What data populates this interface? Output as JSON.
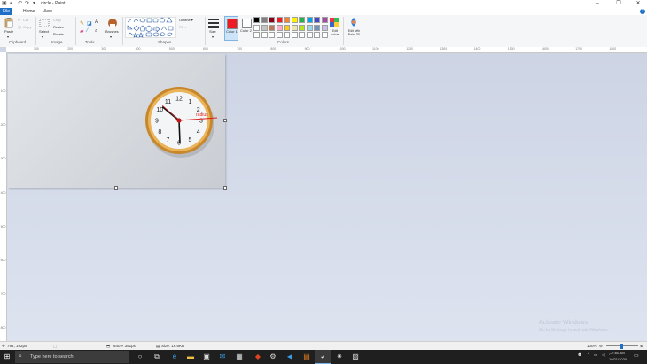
{
  "window": {
    "title": "circle - Paint"
  },
  "tabs": {
    "file": "File",
    "home": "Home",
    "view": "View"
  },
  "clipboard": {
    "paste": "Paste",
    "cut": "Cut",
    "copy": "Copy",
    "label": "Clipboard"
  },
  "image": {
    "select": "Select",
    "crop": "Crop",
    "resize": "Resize",
    "rotate": "Rotate",
    "label": "Image"
  },
  "tools": {
    "label": "Tools",
    "brushes": "Brushes"
  },
  "shapes": {
    "outline": "Outline",
    "fill": "Fill",
    "label": "Shapes"
  },
  "size": {
    "label": "Size"
  },
  "colors": {
    "color1": "Color 1",
    "color2": "Color 2",
    "edit_colors": "Edit colors",
    "edit_with": "Edit with Paint 3D",
    "label": "Colors",
    "color1_value": "#ed1c24",
    "color2_value": "#ffffff",
    "palette": [
      "#000000",
      "#7f7f7f",
      "#880015",
      "#ed1c24",
      "#ff7f27",
      "#fff200",
      "#22b14c",
      "#00a2e8",
      "#3f48cc",
      "#a349a4",
      "#ffffff",
      "#c3c3c3",
      "#b97a57",
      "#ffaec9",
      "#ffc90e",
      "#efe4b0",
      "#b5e61d",
      "#99d9ea",
      "#7092be",
      "#c8bfe7",
      "#ffffff",
      "#ffffff",
      "#ffffff",
      "#ffffff",
      "#ffffff",
      "#ffffff",
      "#ffffff",
      "#ffffff",
      "#ffffff",
      "#ffffff"
    ]
  },
  "ruler": {
    "h": [
      "100",
      "200",
      "300",
      "400",
      "500",
      "600",
      "700",
      "800",
      "900",
      "1000",
      "1100",
      "1200",
      "1300",
      "1400",
      "1500",
      "1600",
      "1700",
      "1800"
    ],
    "v": [
      "100",
      "200",
      "300",
      "400",
      "500",
      "600",
      "700",
      "800"
    ]
  },
  "clock": {
    "radius_text": "radius",
    "numbers": [
      "12",
      "1",
      "2",
      "3",
      "4",
      "5",
      "6",
      "7",
      "8",
      "9",
      "10",
      "11"
    ]
  },
  "status": {
    "cursor": "794, 192px",
    "selection": "640 × 391px",
    "size": "Size: 16.6KB",
    "zoom": "100%"
  },
  "watermark": {
    "line1": "Activate Windows",
    "line2": "Go to Settings to activate Windows."
  },
  "taskbar": {
    "search": "Type here to search",
    "time": "7:46 AM",
    "date": "10/21/2020"
  }
}
